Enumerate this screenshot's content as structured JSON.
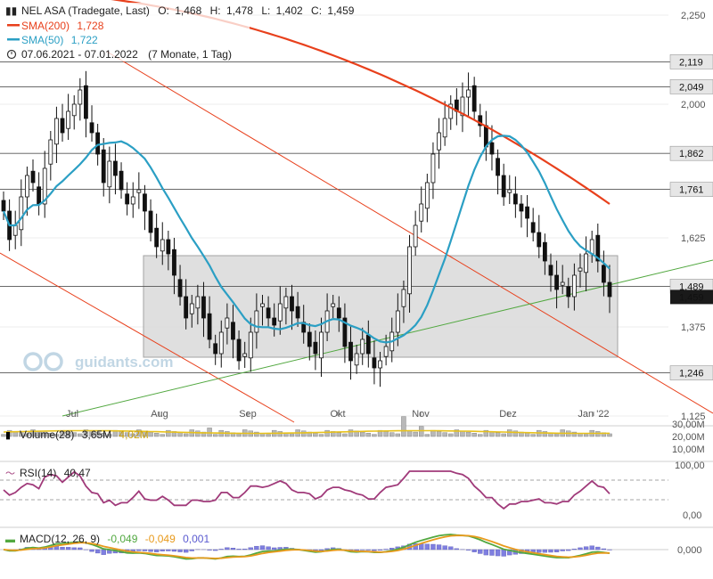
{
  "chart_data": {
    "type": "candlestick",
    "title": "NEL ASA (Tradegate, Last)",
    "ohlc": {
      "o_label": "O:",
      "o": "1,468",
      "h_label": "H:",
      "h": "1,478",
      "l_label": "L:",
      "l": "1,402",
      "c_label": "C:",
      "c": "1,459"
    },
    "legend": [
      {
        "name": "SMA(200)",
        "value": "1,728",
        "color": "#e8401c"
      },
      {
        "name": "SMA(50)",
        "value": "1,722",
        "color": "#2b9fc4"
      }
    ],
    "period_text": "07.06.2021 - 07.01.2022",
    "period_detail": "(7 Monate, 1 Tag)",
    "watermark": "guidants.com",
    "y_ticks": [
      "2,250",
      "2,000",
      "1,625",
      "1,375",
      "1,125"
    ],
    "levels": [
      {
        "label": "2,119",
        "value": 2.119
      },
      {
        "label": "2,049",
        "value": 2.049
      },
      {
        "label": "1,862",
        "value": 1.862
      },
      {
        "label": "1,761",
        "value": 1.761
      },
      {
        "label": "1,489",
        "value": 1.489
      },
      {
        "label": "1,246",
        "value": 1.246
      }
    ],
    "last_price": "1,459",
    "x_ticks": [
      "Jul",
      "Aug",
      "Sep",
      "Okt",
      "Nov",
      "Dez",
      "Jan '22"
    ],
    "ylim": [
      1.125,
      2.25
    ],
    "grid": true,
    "volume": {
      "label": "Volume(28)",
      "value1": "3,65M",
      "value2": "4,02M",
      "ticks": [
        "30,00M",
        "20,00M",
        "10,00M"
      ]
    },
    "rsi": {
      "label": "RSI(14)",
      "value": "40,47",
      "ticks": [
        "100,00",
        "0,00"
      ]
    },
    "macd": {
      "label": "MACD(12, 26, 9)",
      "value1": "-0,049",
      "value2": "-0,049",
      "value3": "0,001",
      "ticks": [
        "0,000"
      ]
    },
    "closes": [
      1.7,
      1.62,
      1.66,
      1.74,
      1.8,
      1.78,
      1.72,
      1.82,
      1.9,
      1.96,
      1.92,
      1.98,
      2.0,
      2.04,
      1.96,
      1.92,
      1.86,
      1.78,
      1.84,
      1.8,
      1.76,
      1.72,
      1.74,
      1.76,
      1.7,
      1.64,
      1.6,
      1.62,
      1.58,
      1.52,
      1.46,
      1.4,
      1.44,
      1.46,
      1.4,
      1.34,
      1.3,
      1.36,
      1.4,
      1.34,
      1.28,
      1.3,
      1.36,
      1.42,
      1.44,
      1.4,
      1.38,
      1.44,
      1.46,
      1.42,
      1.4,
      1.36,
      1.32,
      1.3,
      1.36,
      1.42,
      1.44,
      1.4,
      1.32,
      1.28,
      1.3,
      1.34,
      1.3,
      1.26,
      1.28,
      1.32,
      1.36,
      1.42,
      1.48,
      1.6,
      1.66,
      1.72,
      1.78,
      1.86,
      1.92,
      1.96,
      2.0,
      1.98,
      2.02,
      2.04,
      1.98,
      1.94,
      1.88,
      1.86,
      1.8,
      1.74,
      1.76,
      1.72,
      1.7,
      1.68,
      1.64,
      1.6,
      1.56,
      1.52,
      1.48,
      1.5,
      1.46,
      1.52,
      1.54,
      1.58,
      1.62,
      1.56,
      1.5,
      1.46
    ]
  }
}
